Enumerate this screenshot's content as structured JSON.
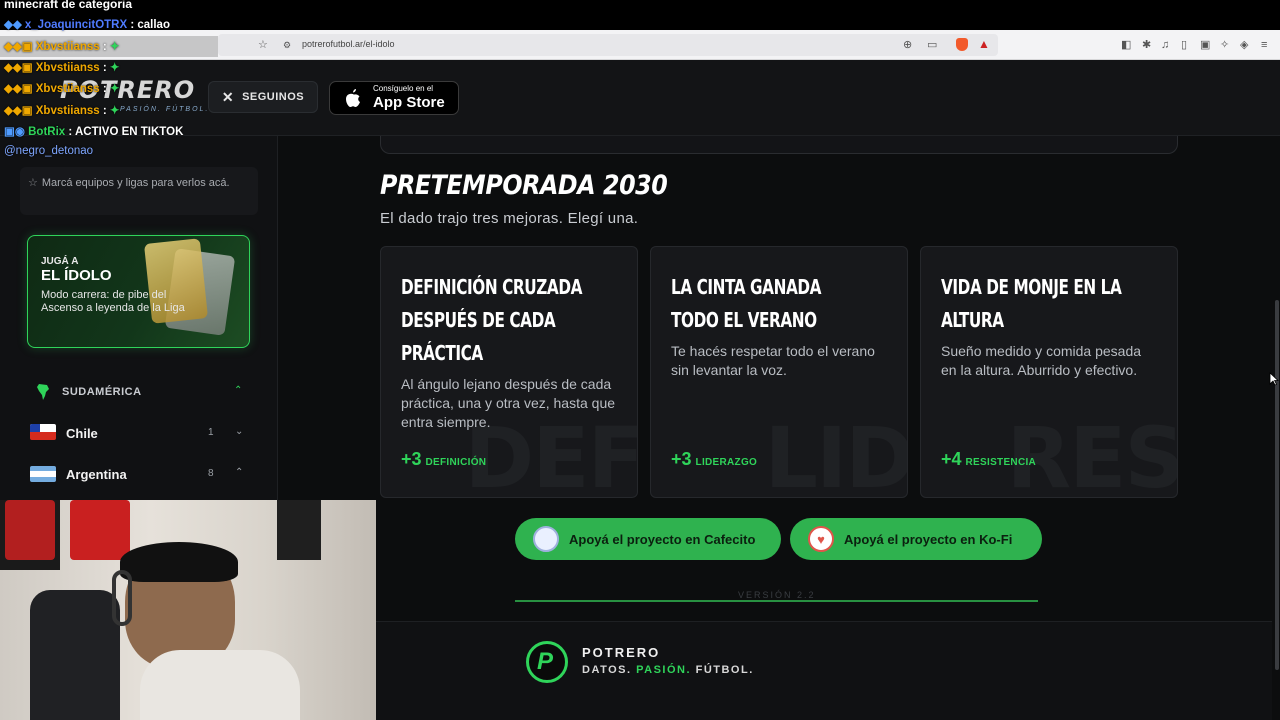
{
  "stream": {
    "title": "minecraft de categoria"
  },
  "chat": [
    {
      "user": "x_JoaquincitOTRX",
      "message": ": callao",
      "color": "#4f7bff"
    },
    {
      "user": "Xbvstiianss",
      "message": ":",
      "color": "#f0a800"
    },
    {
      "user": "Xbvstiianss",
      "message": ":",
      "color": "#f0a800"
    },
    {
      "user": "Xbvstiianss",
      "message": ":",
      "color": "#f0a800"
    },
    {
      "user": "Xbvstiianss",
      "message": ":",
      "color": "#f0a800"
    },
    {
      "user": "BotRix",
      "message": ": ACTIVO EN TIKTOK",
      "color": "#2fd45a"
    },
    {
      "user": "",
      "message": "@negro_detonao",
      "color": "#7ea6ff"
    }
  ],
  "browser": {
    "url": "potrerofutbol.ar/el-idolo"
  },
  "header": {
    "logo": "POTRERO",
    "logo_tagline": "PASIÓN. FÚTBOL.",
    "follow_label": "SEGUINOS",
    "appstore_small": "Consíguelo en el",
    "appstore_big": "App Store"
  },
  "sidebar": {
    "favorites_hint": "Marcá equipos y ligas para verlos acá.",
    "promo": {
      "kicker": "JUGÁ A",
      "title": "EL ÍDOLO",
      "description": "Modo carrera: de pibe del Ascenso a leyenda de la Liga"
    },
    "region": "SUDAMÉRICA",
    "countries": [
      {
        "name": "Chile",
        "count": "1",
        "expanded": false
      },
      {
        "name": "Argentina",
        "count": "8",
        "expanded": true
      }
    ]
  },
  "main": {
    "title": "PRETEMPORADA 2030",
    "subtitle": "El dado trajo tres mejoras. Elegí una.",
    "cards": [
      {
        "title": "DEFINICIÓN CRUZADA DESPUÉS DE CADA PRÁCTICA",
        "description": "Al ángulo lejano después de cada práctica, una y otra vez, hasta que entra siempre.",
        "bonus": "+3",
        "stat": "DEFINICIÓN",
        "watermark": "DEF"
      },
      {
        "title": "LA CINTA GANADA TODO EL VERANO",
        "description": "Te hacés respetar todo el verano sin levantar la voz.",
        "bonus": "+3",
        "stat": "LIDERAZGO",
        "watermark": "LID"
      },
      {
        "title": "VIDA DE MONJE EN LA ALTURA",
        "description": "Sueño medido y comida pesada en la altura. Aburrido y efectivo.",
        "bonus": "+4",
        "stat": "RESISTENCIA",
        "watermark": "RES"
      }
    ],
    "support_cafecito": "Apoyá el proyecto en Cafecito",
    "support_kofi": "Apoyá el proyecto en Ko-Fi",
    "version": "VERSIÓN 2.2"
  },
  "footer": {
    "brand": "POTRERO",
    "tag_1": "DATOS.",
    "tag_2": "PASIÓN.",
    "tag_3": "FÚTBOL."
  },
  "colors": {
    "accent": "#2fd45a",
    "background": "#0c0d0e",
    "card": "#17181b"
  }
}
